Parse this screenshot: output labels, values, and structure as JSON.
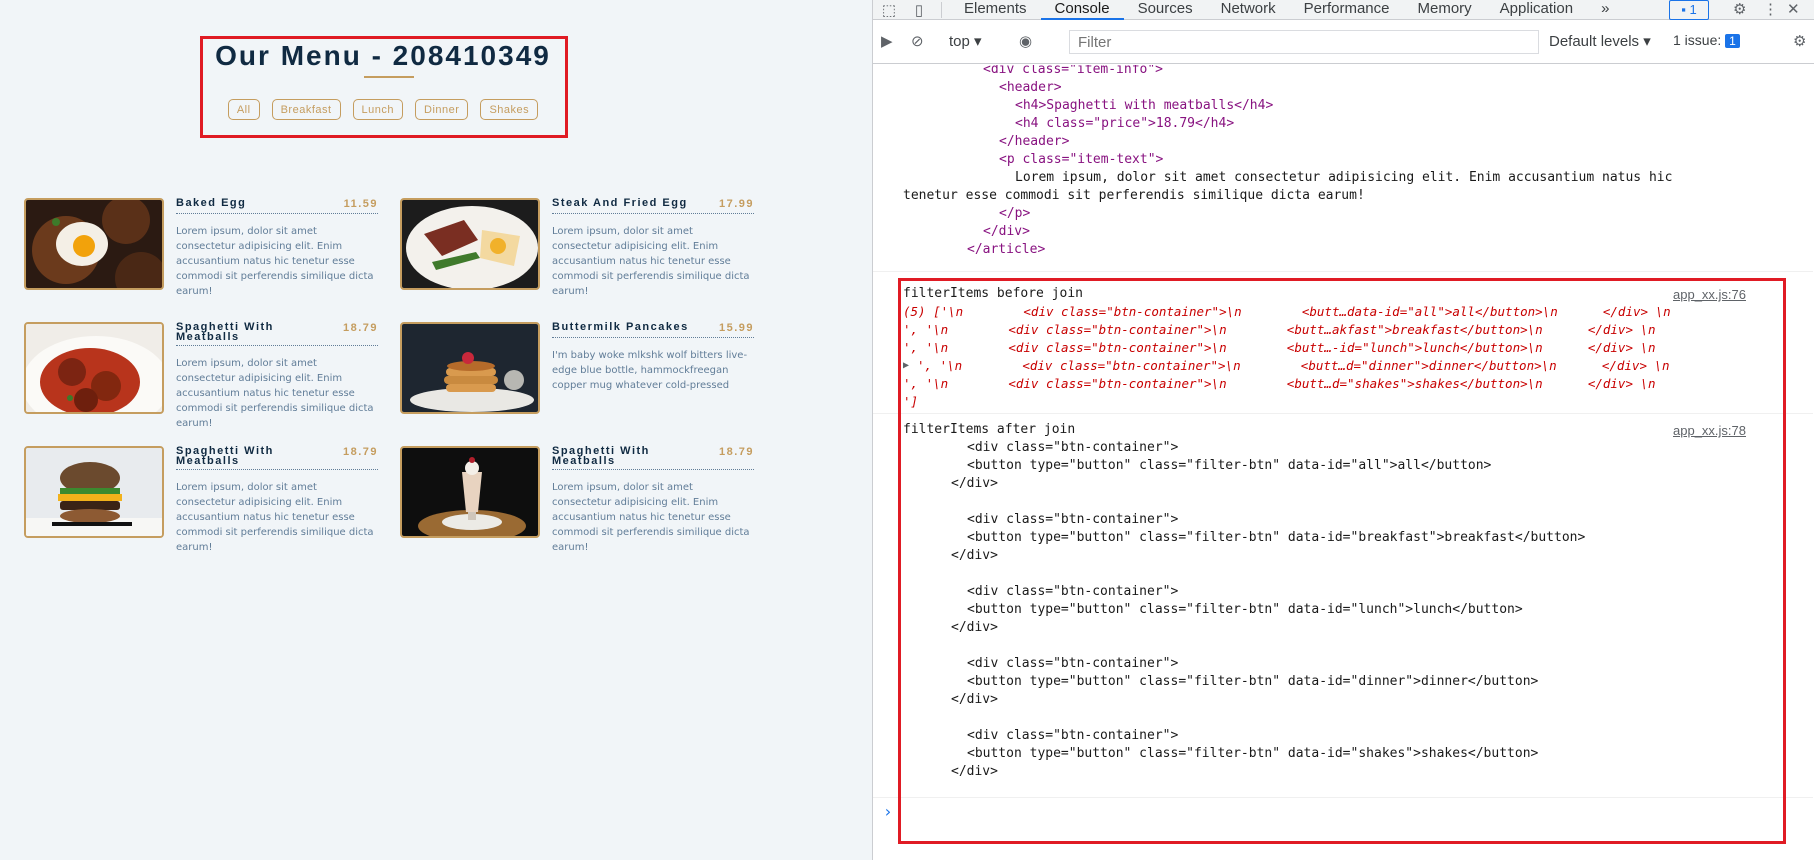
{
  "menu": {
    "title": "Our Menu - 208410349",
    "filters": [
      "All",
      "Breakfast",
      "Lunch",
      "Dinner",
      "Shakes"
    ],
    "items": [
      {
        "name": "Baked Egg",
        "price": "11.59",
        "text": "Lorem ipsum, dolor sit amet consectetur adipisicing elit. Enim accusantium natus hic tenetur esse commodi sit perferendis similique dicta earum!",
        "photo": "egg"
      },
      {
        "name": "Steak And Fried Egg",
        "price": "17.99",
        "text": "Lorem ipsum, dolor sit amet consectetur adipisicing elit. Enim accusantium natus hic tenetur esse commodi sit perferendis similique dicta earum!",
        "photo": "steak"
      },
      {
        "name": "Spaghetti With Meatballs",
        "price": "18.79",
        "text": "Lorem ipsum, dolor sit amet consectetur adipisicing elit. Enim accusantium natus hic tenetur esse commodi sit perferendis similique dicta earum!",
        "photo": "spaghetti"
      },
      {
        "name": "Buttermilk Pancakes",
        "price": "15.99",
        "text": "I'm baby woke mlkshk wolf bitters live-edge blue bottle, hammockfreegan copper mug whatever cold-pressed",
        "photo": "pancakes"
      },
      {
        "name": "Spaghetti With Meatballs",
        "price": "18.79",
        "text": "Lorem ipsum, dolor sit amet consectetur adipisicing elit. Enim accusantium natus hic tenetur esse commodi sit perferendis similique dicta earum!",
        "photo": "burger"
      },
      {
        "name": "Spaghetti With Meatballs",
        "price": "18.79",
        "text": "Lorem ipsum, dolor sit amet consectetur adipisicing elit. Enim accusantium natus hic tenetur esse commodi sit perferendis similique dicta earum!",
        "photo": "shake"
      }
    ]
  },
  "devtools": {
    "tabs": [
      "Elements",
      "Console",
      "Sources",
      "Network",
      "Performance",
      "Memory",
      "Application"
    ],
    "active_tab": "Console",
    "more_tabs": "»",
    "issues_badge": "1",
    "context": "top",
    "filter_placeholder": "Filter",
    "levels": "Default levels",
    "issues_label": "1 issue:",
    "issues_count": "1",
    "prompt": "›"
  },
  "console": {
    "top_lines": [
      "<div class=\"item-info\">",
      "<header>",
      "<h4>Spaghetti with meatballs</h4>",
      "<h4 class=\"price\">18.79</h4>",
      "</header>",
      "<p class=\"item-text\">",
      "Lorem ipsum, dolor sit amet consectetur adipisicing elit. Enim accusantium natus hic",
      "tenetur esse commodi sit perferendis similique dicta earum!",
      "</p>",
      "</div>",
      "</article>"
    ],
    "before_label": "filterItems before join",
    "before_source": "app_xx.js:76",
    "array_open": "(5) ['\\n        <div class=\"btn-container\">\\n        <butt…data-id=\"all\">all</button>\\n      </div> \\n",
    "array_rows": [
      "', '\\n        <div class=\"btn-container\">\\n        <butt…akfast\">breakfast</button>\\n      </div> \\n",
      "', '\\n        <div class=\"btn-container\">\\n        <butt…-id=\"lunch\">lunch</button>\\n      </div> \\n",
      "', '\\n        <div class=\"btn-container\">\\n        <butt…d=\"dinner\">dinner</button>\\n      </div> \\n",
      "', '\\n        <div class=\"btn-container\">\\n        <butt…d=\"shakes\">shakes</button>\\n      </div> \\n"
    ],
    "array_close": "']",
    "after_label": "filterItems after join",
    "after_source": "app_xx.js:78",
    "after_blocks": [
      {
        "open": "<div class=\"btn-container\">",
        "button": "<button type=\"button\" class=\"filter-btn\" data-id=\"all\">all</button>",
        "close": "</div>"
      },
      {
        "open": "<div class=\"btn-container\">",
        "button": "<button type=\"button\" class=\"filter-btn\" data-id=\"breakfast\">breakfast</button>",
        "close": "</div>"
      },
      {
        "open": "<div class=\"btn-container\">",
        "button": "<button type=\"button\" class=\"filter-btn\" data-id=\"lunch\">lunch</button>",
        "close": "</div>"
      },
      {
        "open": "<div class=\"btn-container\">",
        "button": "<button type=\"button\" class=\"filter-btn\" data-id=\"dinner\">dinner</button>",
        "close": "</div>"
      },
      {
        "open": "<div class=\"btn-container\">",
        "button": "<button type=\"button\" class=\"filter-btn\" data-id=\"shakes\">shakes</button>",
        "close": "</div>"
      }
    ]
  },
  "colors": {
    "accent": "#c59d5f",
    "heading": "#102a42",
    "highlight": "#e01b24",
    "devtools_blue": "#1a73e8"
  }
}
